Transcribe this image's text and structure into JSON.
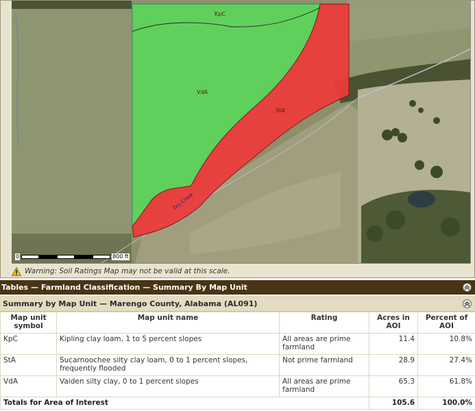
{
  "map": {
    "units": [
      "KpC",
      "VdA",
      "StA"
    ],
    "road_label": "Dry Creek",
    "scale": {
      "zero": "0",
      "max": "800 ft"
    },
    "warning_text": "Warning: Soil Ratings Map may not be valid at this scale.",
    "colors": {
      "prime": "#5cd65c",
      "not_prime": "#ee3b3b"
    }
  },
  "tables_header": "Tables — Farmland Classification — Summary By Map Unit",
  "summary": {
    "title": "Summary by Map Unit — Marengo County, Alabama (AL091)",
    "columns": [
      "Map unit symbol",
      "Map unit name",
      "Rating",
      "Acres in AOI",
      "Percent of AOI"
    ],
    "rows": [
      {
        "symbol": "KpC",
        "name": "Kipling clay loam, 1 to 5 percent slopes",
        "rating": "All areas are prime farmland",
        "acres": "11.4",
        "percent": "10.8%"
      },
      {
        "symbol": "StA",
        "name": "Sucarnoochee silty clay loam, 0 to 1 percent slopes, frequently flooded",
        "rating": "Not prime farmland",
        "acres": "28.9",
        "percent": "27.4%"
      },
      {
        "symbol": "VdA",
        "name": "Vaiden silty clay, 0 to 1 percent slopes",
        "rating": "All areas are prime farmland",
        "acres": "65.3",
        "percent": "61.8%"
      }
    ],
    "totals": {
      "label": "Totals for Area of Interest",
      "acres": "105.6",
      "percent": "100.0%"
    }
  }
}
